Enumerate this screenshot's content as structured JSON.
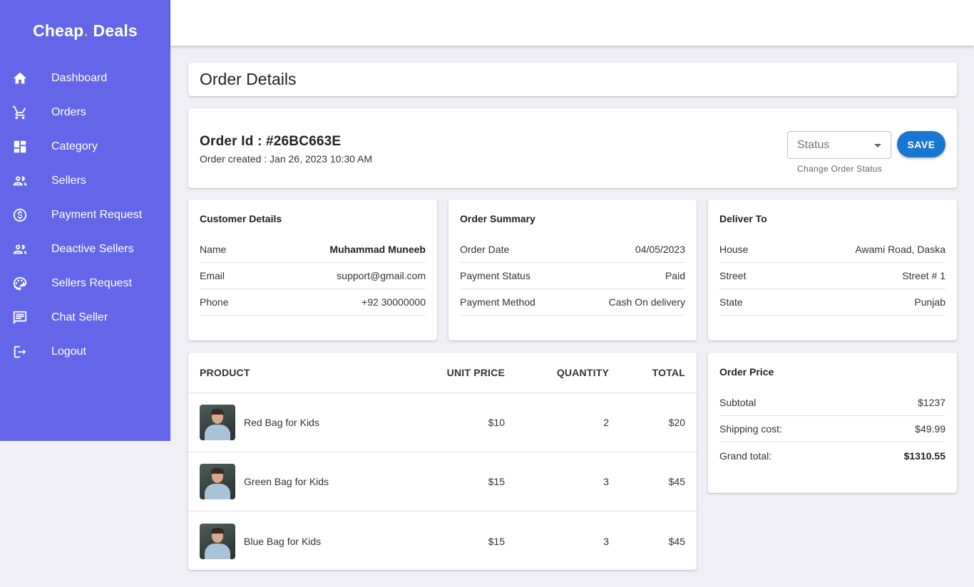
{
  "brand": {
    "name": "Cheap",
    "dot": ".",
    "suffix": " Deals"
  },
  "colors": {
    "sidebar_bg": "#6366e9",
    "accent_dot": "#ff9a3c",
    "save_button": "#1976d2",
    "page_bg": "#f0eff5"
  },
  "sidebar": {
    "items": [
      {
        "label": "Dashboard",
        "icon": "home-icon"
      },
      {
        "label": "Orders",
        "icon": "cart-icon"
      },
      {
        "label": "Category",
        "icon": "dashboard-grid-icon"
      },
      {
        "label": "Sellers",
        "icon": "people-icon"
      },
      {
        "label": "Payment Request",
        "icon": "dollar-circle-icon"
      },
      {
        "label": "Deactive Sellers",
        "icon": "people-icon"
      },
      {
        "label": "Sellers Request",
        "icon": "palette-icon"
      },
      {
        "label": "Chat Seller",
        "icon": "chat-icon"
      },
      {
        "label": "Logout",
        "icon": "logout-icon"
      }
    ]
  },
  "page": {
    "title": "Order Details"
  },
  "order": {
    "id_label": "Order Id : #26BC663E",
    "created": "Order created : Jan 26, 2023 10:30 AM",
    "status_placeholder": "Status",
    "status_helper": "Change Order Status",
    "save_label": "SAVE"
  },
  "customer": {
    "title": "Customer Details",
    "rows": [
      {
        "label": "Name",
        "value": "Muhammad Muneeb"
      },
      {
        "label": "Email",
        "value": "support@gmail.com"
      },
      {
        "label": "Phone",
        "value": "+92 30000000"
      }
    ]
  },
  "summary": {
    "title": "Order Summary",
    "rows": [
      {
        "label": "Order Date",
        "value": "04/05/2023"
      },
      {
        "label": "Payment Status",
        "value": "Paid"
      },
      {
        "label": "Payment Method",
        "value": "Cash On delivery"
      }
    ]
  },
  "deliver": {
    "title": "Deliver To",
    "rows": [
      {
        "label": "House",
        "value": "Awami Road, Daska"
      },
      {
        "label": "Street",
        "value": "Street # 1"
      },
      {
        "label": "State",
        "value": "Punjab"
      }
    ]
  },
  "products": {
    "headers": {
      "product": "PRODUCT",
      "unit_price": "UNIT PRICE",
      "quantity": "QUANTITY",
      "total": "TOTAL"
    },
    "rows": [
      {
        "name": "Red Bag for Kids",
        "unit_price": "$10",
        "quantity": "2",
        "total": "$20"
      },
      {
        "name": "Green Bag for Kids",
        "unit_price": "$15",
        "quantity": "3",
        "total": "$45"
      },
      {
        "name": "Blue Bag for Kids",
        "unit_price": "$15",
        "quantity": "3",
        "total": "$45"
      }
    ]
  },
  "price": {
    "title": "Order Price",
    "rows": [
      {
        "label": "Subtotal",
        "value": "$1237"
      },
      {
        "label": "Shipping cost:",
        "value": "$49.99"
      },
      {
        "label": "Grand total:",
        "value": "$1310.55"
      }
    ]
  }
}
